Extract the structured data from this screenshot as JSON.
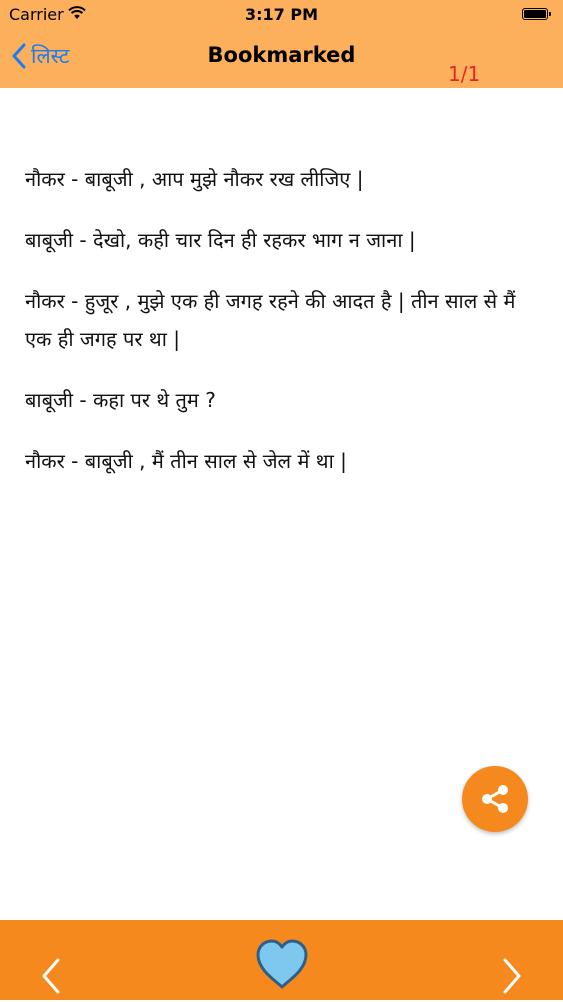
{
  "status_bar": {
    "carrier": "Carrier",
    "time": "3:17 PM",
    "icons": [
      "wifi-icon",
      "battery-icon"
    ]
  },
  "nav": {
    "back_label": "लिस्ट",
    "title": "Bookmarked",
    "page_counter": "1/1",
    "colors": {
      "bar": "#fdb05b",
      "back": "#1e7bf2",
      "counter": "#e4262c"
    }
  },
  "content": {
    "paragraphs": [
      "नौकर - बाबूजी , आप मुझे नौकर रख लीजिए |",
      "बाबूजी - देखो, कही चार दिन ही रहकर भाग न जाना |",
      "नौकर - हुजूर , मुझे एक ही जगह रहने की आदत है | तीन साल से मैं एक ही जगह पर था |",
      "बाबूजी - कहा पर थे तुम ?",
      "नौकर - बाबूजी , मैं तीन साल से जेल में था |"
    ]
  },
  "share": {
    "icon": "share-icon",
    "color": "#f5891e"
  },
  "bottom_bar": {
    "color": "#f5891e",
    "icons": [
      "chevron-left-icon",
      "heart-icon",
      "chevron-right-icon"
    ],
    "heart_color": "#7ec8f0"
  }
}
